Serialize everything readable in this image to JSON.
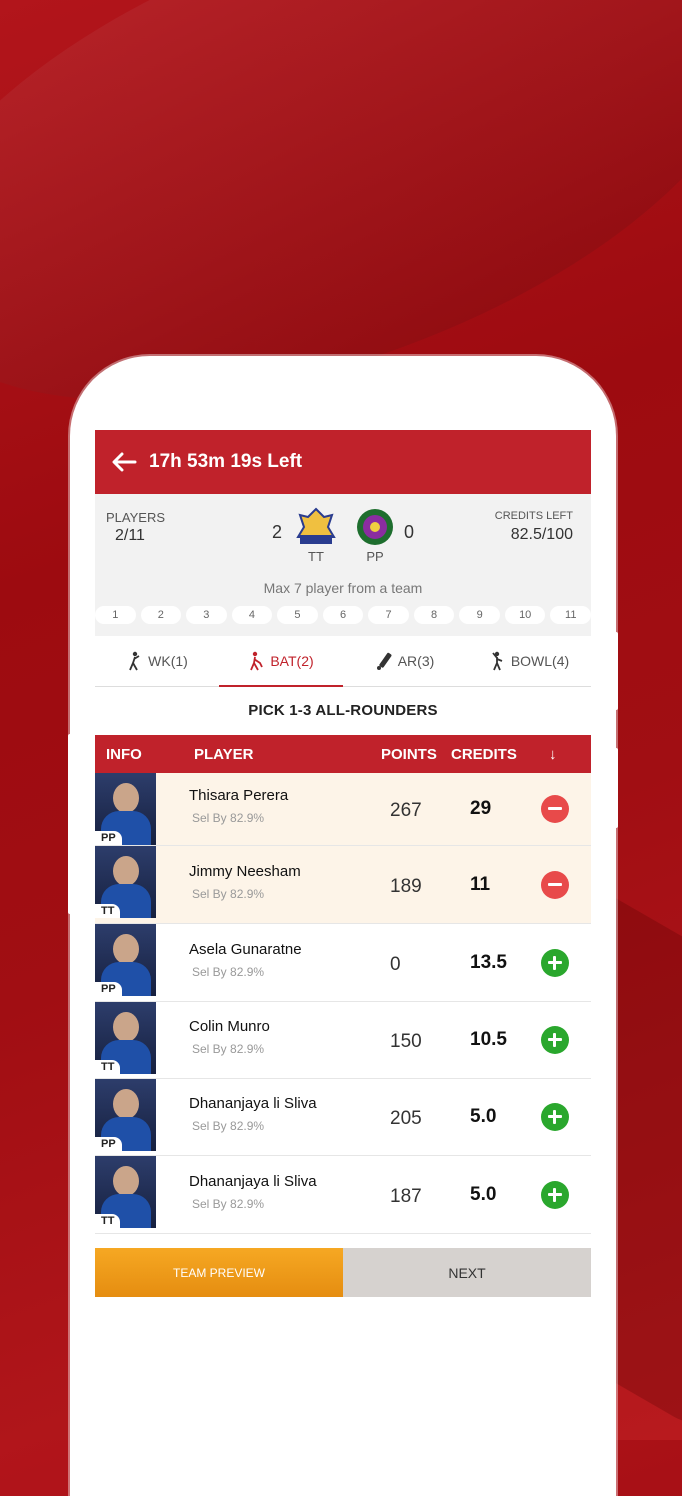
{
  "topbar": {
    "timer": "17h 53m 19s Left"
  },
  "summary": {
    "players_label": "PLAYERS",
    "players_value": "2/11",
    "team1_score": "2",
    "team1_code": "TT",
    "team2_score": "0",
    "team2_code": "PP",
    "credits_label": "CREDITS LEFT",
    "credits_value": "82.5/100",
    "max_note": "Max 7 player from a team",
    "slots": [
      "1",
      "2",
      "3",
      "4",
      "5",
      "6",
      "7",
      "8",
      "9",
      "10",
      "11"
    ]
  },
  "tabs": [
    {
      "label": "WK(1)",
      "icon": "wicketkeeper-icon"
    },
    {
      "label": "BAT(2)",
      "icon": "batsman-icon"
    },
    {
      "label": "AR(3)",
      "icon": "allrounder-icon"
    },
    {
      "label": "BOWL(4)",
      "icon": "bowler-icon"
    }
  ],
  "pick_line": "PICK 1-3 ALL-ROUNDERS",
  "table": {
    "headers": {
      "info": "INFO",
      "player": "PLAYER",
      "points": "POINTS",
      "credits": "CREDITS",
      "sort": "↓"
    },
    "rows": [
      {
        "team": "PP",
        "name": "Thisara Perera",
        "sel": "Sel By 82.9%",
        "points": "267",
        "credits": "29",
        "state": "selected"
      },
      {
        "team": "TT",
        "name": "Jimmy Neesham",
        "sel": "Sel By 82.9%",
        "points": "189",
        "credits": "11",
        "state": "selected"
      },
      {
        "team": "PP",
        "name": "Asela Gunaratne",
        "sel": "Sel By 82.9%",
        "points": "0",
        "credits": "13.5",
        "state": "available"
      },
      {
        "team": "TT",
        "name": "Colin Munro",
        "sel": "Sel By 82.9%",
        "points": "150",
        "credits": "10.5",
        "state": "available"
      },
      {
        "team": "PP",
        "name": "Dhananjaya li Sliva",
        "sel": "Sel By 82.9%",
        "points": "205",
        "credits": "5.0",
        "state": "available"
      },
      {
        "team": "TT",
        "name": "Dhananjaya li Sliva",
        "sel": "Sel By 82.9%",
        "points": "187",
        "credits": "5.0",
        "state": "available"
      }
    ]
  },
  "footer": {
    "preview": "TEAM PREVIEW",
    "next": "NEXT"
  },
  "colors": {
    "brand_red": "#c0222b",
    "orange": "#f6a823",
    "minus": "#e84a4a",
    "plus": "#2aa72d"
  }
}
